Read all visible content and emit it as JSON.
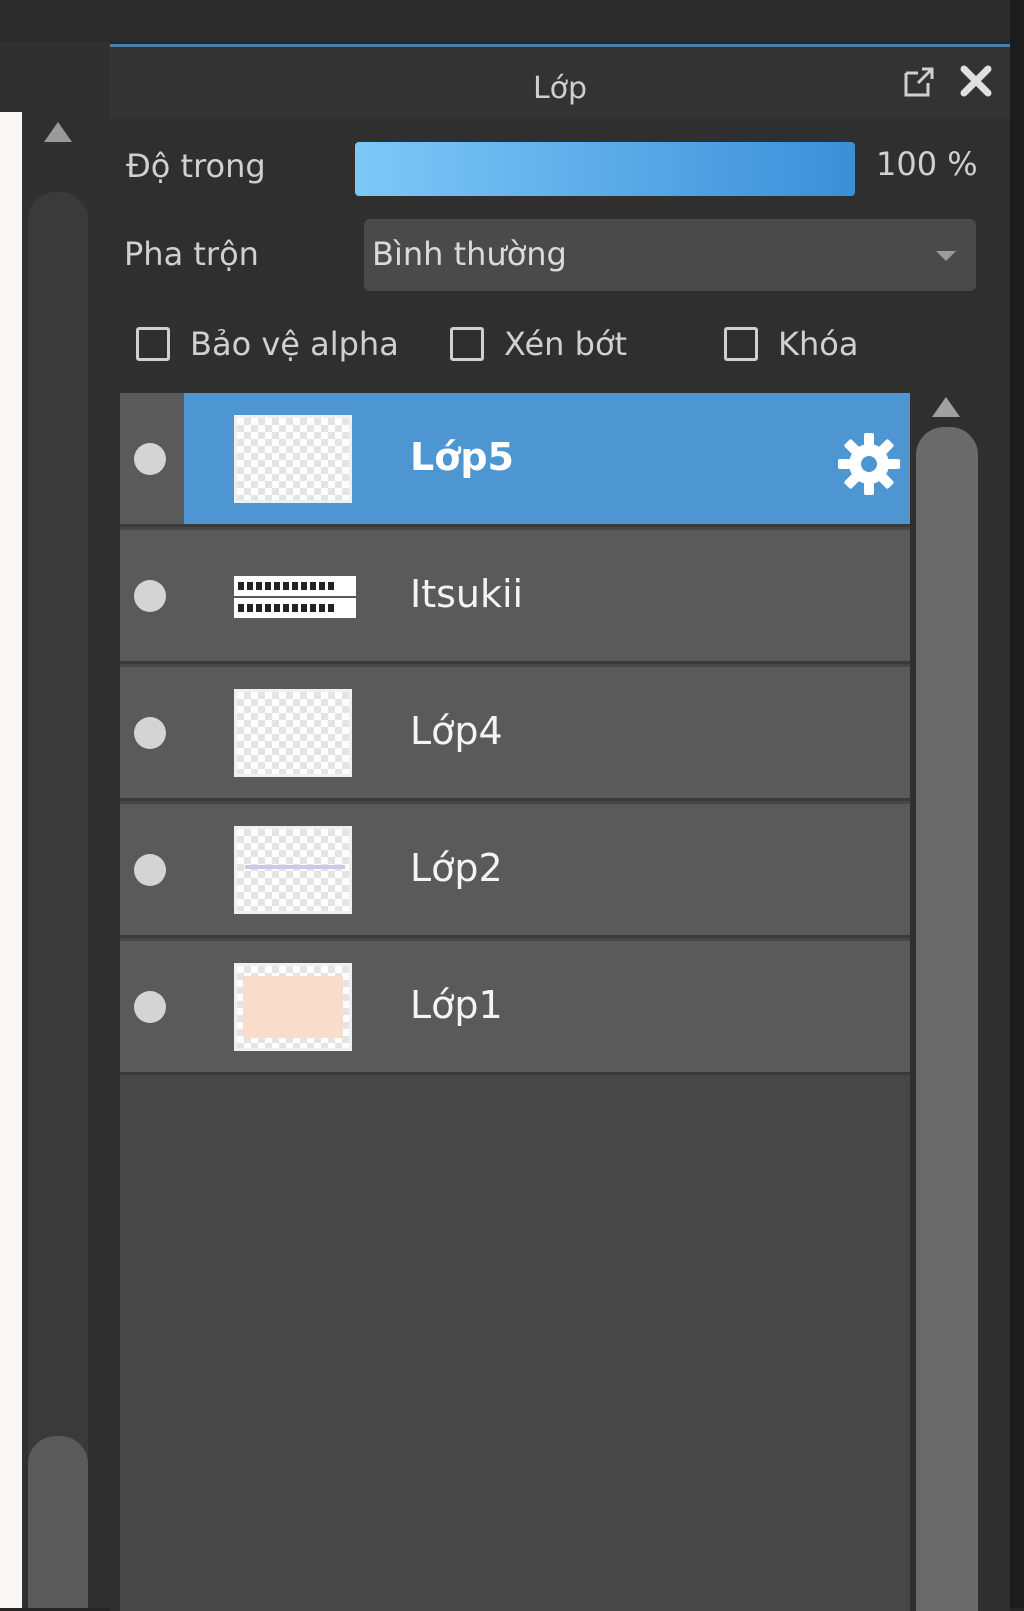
{
  "panel": {
    "title": "Lớp",
    "opacity_label": "Độ trong",
    "opacity_value_text": "100 %",
    "opacity_percent": 100,
    "blend_label": "Pha trộn",
    "blend_value": "Bình thường",
    "checkboxes": [
      {
        "label": "Bảo vệ alpha",
        "checked": false
      },
      {
        "label": "Xén bớt",
        "checked": false
      },
      {
        "label": "Khóa",
        "checked": false
      }
    ]
  },
  "layers": [
    {
      "name": "Lớp5",
      "selected": true,
      "thumbnail": "transparent"
    },
    {
      "name": "Itsukii",
      "selected": false,
      "thumbnail": "text"
    },
    {
      "name": "Lớp4",
      "selected": false,
      "thumbnail": "transparent"
    },
    {
      "name": "Lớp2",
      "selected": false,
      "thumbnail": "lines"
    },
    {
      "name": "Lớp1",
      "selected": false,
      "thumbnail": "peach"
    }
  ],
  "icons": {
    "popout": "popout-icon",
    "close": "close-icon",
    "settings": "gear-icon",
    "visibility": "visibility-dot-icon"
  },
  "colors": {
    "accent": "#4d96d2",
    "opacity_gradient_start": "#7ec8f8",
    "opacity_gradient_end": "#3a8fd8"
  }
}
